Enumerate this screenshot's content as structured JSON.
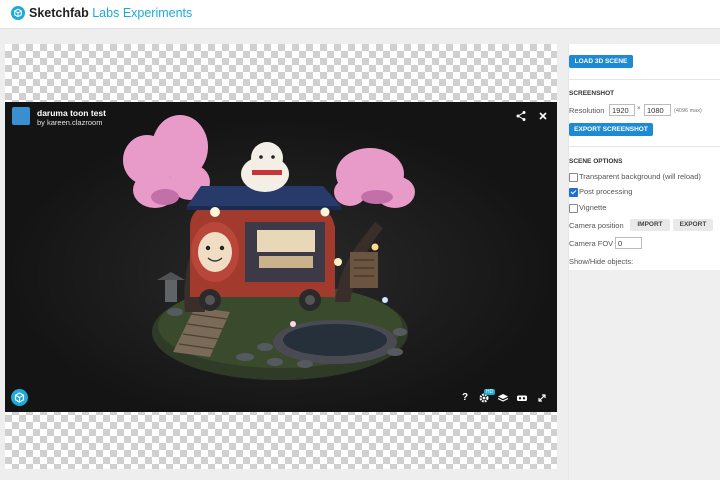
{
  "header": {
    "brand_main": "Sketchfab",
    "brand_sub": "Labs Experiments"
  },
  "viewer": {
    "model_title": "daruma toon test",
    "model_author": "by kareen.clazroom",
    "hd_badge": "HD",
    "icons": [
      "share-icon",
      "close-icon",
      "help-icon",
      "settings-icon",
      "layers-icon",
      "vr-icon",
      "fullscreen-icon",
      "sketchfab-logo-icon"
    ],
    "help_glyph": "?"
  },
  "panel": {
    "load_button": "LOAD 3D SCENE",
    "screenshot": {
      "title": "SCREENSHOT",
      "resolution_label": "Resolution",
      "width_value": "1920",
      "times": "×",
      "height_value": "1080",
      "max_note": "(4096 max)",
      "export_button": "EXPORT SCREENSHOT"
    },
    "scene_options": {
      "title": "SCENE OPTIONS",
      "transparent_label": "Transparent background (will reload)",
      "transparent_checked": false,
      "post_processing_label": "Post processing",
      "post_processing_checked": true,
      "vignette_label": "Vignette",
      "vignette_checked": false,
      "camera_position_label": "Camera position",
      "import_button": "IMPORT",
      "export_button": "EXPORT",
      "camera_fov_label": "Camera FOV",
      "camera_fov_value": "0",
      "show_hide_label": "Show/Hide objects:"
    }
  },
  "colors": {
    "accent": "#1caad9",
    "button_blue": "#1f8ad4",
    "viewer_bg": "#161616"
  }
}
